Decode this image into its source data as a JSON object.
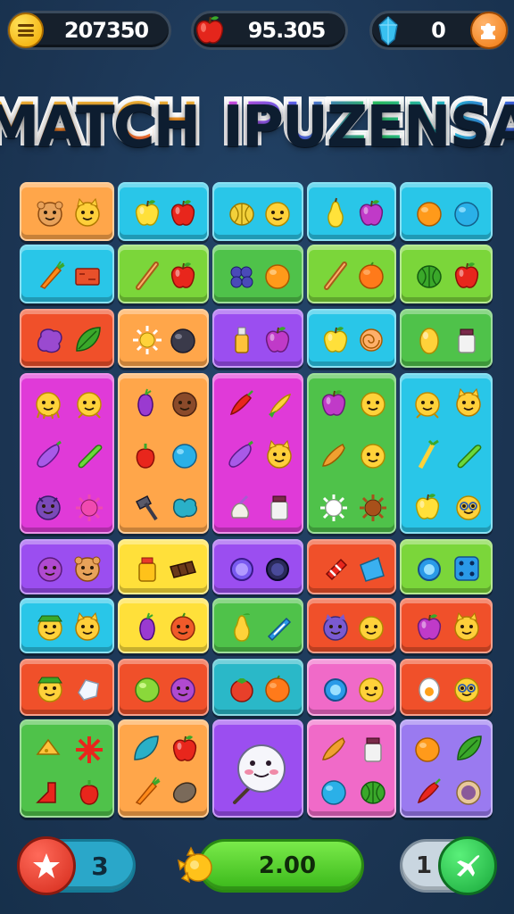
{
  "hud": {
    "coins": "207350",
    "apples": "95.305",
    "gems": "0",
    "icons": {
      "menu": "menu-icon",
      "apple": "apple-icon",
      "gem": "gem-icon",
      "add": "puzzle-icon"
    }
  },
  "title": {
    "word1": "MATCH",
    "word2": "IPUZENSA"
  },
  "bottom": {
    "lives": "3",
    "score": "2.00",
    "moves": "1",
    "icons": {
      "left": "star-icon",
      "mid": "sun-icon",
      "right": "airplane-icon"
    }
  },
  "colors": {
    "orange": "#ff9a3a",
    "cyan": "#29c6e8",
    "green": "#4fc24a",
    "lime": "#7bd63a",
    "magenta": "#e03ad8",
    "purple": "#9b4ef0",
    "yellow": "#ffe03a",
    "red": "#f0502a",
    "pink": "#f06ac8",
    "teal": "#2ab8c8",
    "peach": "#ffa64a",
    "lavender": "#9a7af0"
  },
  "board": {
    "tiles": [
      {
        "color": "peach",
        "items": [
          "bear-face",
          "cat-face"
        ]
      },
      {
        "color": "cyan",
        "items": [
          "yellow-apple",
          "red-apple"
        ]
      },
      {
        "color": "cyan",
        "items": [
          "melon",
          "smiley"
        ]
      },
      {
        "color": "cyan",
        "items": [
          "pear",
          "plum"
        ]
      },
      {
        "color": "cyan",
        "items": [
          "orange",
          "blue-ball"
        ]
      },
      {
        "color": "cyan",
        "items": [
          "carrot",
          "red-brick"
        ]
      },
      {
        "color": "lime",
        "items": [
          "stick",
          "red-apple"
        ]
      },
      {
        "color": "green",
        "items": [
          "berries",
          "orange"
        ]
      },
      {
        "color": "lime",
        "items": [
          "stick",
          "orange-fruit"
        ]
      },
      {
        "color": "lime",
        "items": [
          "green-melon",
          "red-apple"
        ]
      },
      {
        "color": "red",
        "items": [
          "purple-blob",
          "leaf"
        ]
      },
      {
        "color": "peach",
        "items": [
          "sun",
          "dark-ball"
        ]
      },
      {
        "color": "purple",
        "items": [
          "bottle",
          "plum"
        ]
      },
      {
        "color": "cyan",
        "items": [
          "yellow-apple",
          "snail"
        ]
      },
      {
        "color": "green",
        "items": [
          "lemon",
          "jar"
        ]
      },
      {
        "color": "magenta",
        "items": [
          "octopus",
          "chick",
          "eggplant",
          "cucumber",
          "purple-monster",
          "pink-spike"
        ]
      },
      {
        "color": "peach",
        "items": [
          "grape",
          "brown-face",
          "red-pepper",
          "blue-ball",
          "hammer",
          "blue-splat"
        ]
      },
      {
        "color": "magenta",
        "items": [
          "red-chili",
          "corn",
          "eggplant",
          "cat-face",
          "garlic",
          "jar"
        ]
      },
      {
        "color": "green",
        "items": [
          "plum",
          "smiley",
          "pear-orange",
          "smiley",
          "white-spike",
          "brown-spike"
        ]
      },
      {
        "color": "cyan",
        "items": [
          "chick",
          "cat-face",
          "leek",
          "cucumber",
          "yellow-apple",
          "glasses-face"
        ]
      },
      {
        "color": "purple",
        "items": [
          "plum-face",
          "bear-face"
        ]
      },
      {
        "color": "yellow",
        "items": [
          "honey-jar",
          "chocolate"
        ]
      },
      {
        "color": "purple",
        "items": [
          "ring",
          "dark-ring"
        ]
      },
      {
        "color": "red",
        "items": [
          "candy",
          "blue-box"
        ]
      },
      {
        "color": "lime",
        "items": [
          "blue-ring",
          "blue-die"
        ]
      },
      {
        "color": "cyan",
        "items": [
          "hat-face",
          "cat-face"
        ]
      },
      {
        "color": "yellow",
        "items": [
          "grape",
          "red-face"
        ]
      },
      {
        "color": "green",
        "items": [
          "yellow-pear",
          "blue-candy"
        ]
      },
      {
        "color": "red",
        "items": [
          "purple-cat",
          "smiley"
        ]
      },
      {
        "color": "red",
        "items": [
          "plum",
          "cat-face"
        ]
      },
      {
        "color": "red",
        "items": [
          "hat-face",
          "white-splat"
        ]
      },
      {
        "color": "red",
        "items": [
          "lime-ball",
          "plum-face"
        ]
      },
      {
        "color": "teal",
        "items": [
          "tomato",
          "orange-fruit"
        ]
      },
      {
        "color": "pink",
        "items": [
          "blue-ring",
          "smiley"
        ]
      },
      {
        "color": "red",
        "items": [
          "egg",
          "glasses-face"
        ]
      },
      {
        "color": "green",
        "items": [
          "cheese",
          "red-spike",
          "boot",
          "red-pepper"
        ]
      },
      {
        "color": "peach",
        "items": [
          "blue-leaf",
          "red-apple",
          "carrot",
          "brown-stone"
        ]
      },
      {
        "color": "purple",
        "items": [
          "snowman-lollipop"
        ]
      },
      {
        "color": "pink",
        "items": [
          "pear-orange",
          "jar",
          "blue-ball",
          "green-melon"
        ]
      },
      {
        "color": "lavender",
        "items": [
          "orange",
          "leaf",
          "red-chili",
          "cookie"
        ]
      }
    ]
  }
}
